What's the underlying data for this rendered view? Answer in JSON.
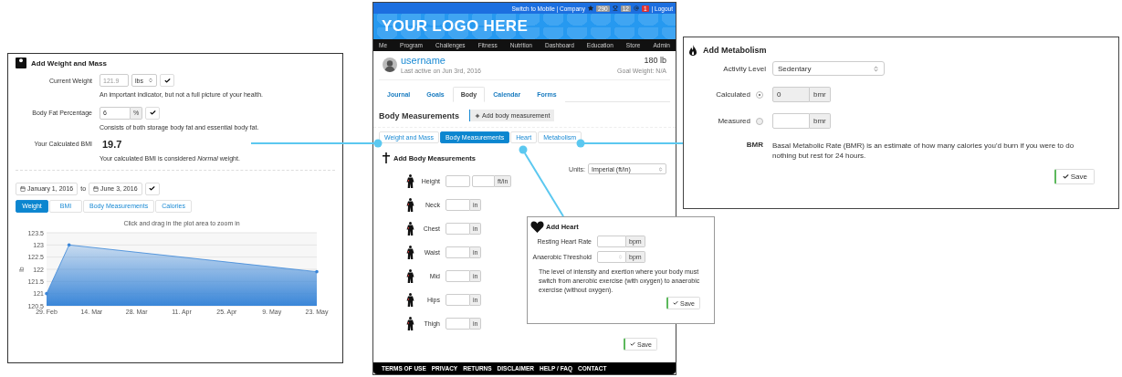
{
  "weight_panel": {
    "title": "Add Weight and Mass",
    "current_weight": {
      "label": "Current Weight",
      "placeholder": "121.9",
      "unit": "lbs",
      "help": "An important indicator, but not a full picture of your health."
    },
    "body_fat": {
      "label": "Body Fat Percentage",
      "value": "6",
      "unit": "%",
      "help": "Consists of both storage body fat and essential body fat."
    },
    "bmi": {
      "label": "Your Calculated BMI",
      "value": "19.7",
      "note": "Your calculated BMI is considered *Normal* weight."
    },
    "date_range": {
      "from": "January 1, 2016",
      "joiner": "to",
      "to": "June 3, 2016"
    },
    "tabs": [
      {
        "label": "Weight",
        "selected": true
      },
      {
        "label": "BMI",
        "selected": false
      },
      {
        "label": "Body Measurements",
        "selected": false
      },
      {
        "label": "Calories",
        "selected": false
      }
    ],
    "chart_data": {
      "type": "area",
      "title": "Click and drag in the plot area to zoom in",
      "ylabel": "lb",
      "categories": [
        "29. Feb",
        null,
        "14. Mar",
        null,
        "28. Mar",
        null,
        "11. Apr",
        null,
        "25. Apr",
        null,
        "9. May",
        null,
        "23. May"
      ],
      "ylim": [
        120.5,
        123.5
      ],
      "grid": "y",
      "series": [
        {
          "color": "#3a86d8",
          "values": [
            121,
            123,
            null,
            null,
            null,
            null,
            null,
            null,
            null,
            null,
            null,
            null,
            121.9
          ]
        }
      ],
      "yticks": [
        120.5,
        121,
        121.5,
        122,
        122.5,
        123,
        123.5
      ]
    }
  },
  "site": {
    "top_bar": {
      "links": "Switch to Mobile | Company",
      "stars": "290",
      "trophies": "12",
      "alerts": "1",
      "logout": "| Logout"
    },
    "logo": "YOUR LOGO HERE",
    "nav": [
      "Me",
      "Program",
      "Challenges",
      "Fitness",
      "Nutrition",
      "Dashboard",
      "Education",
      "Store",
      "Admin"
    ],
    "profile": {
      "username": "username",
      "last_active": "Last active on Jun 3rd, 2016",
      "weight": "180 lb",
      "goal": "Goal Weight: N/A"
    },
    "tabs": [
      {
        "label": "Journal",
        "selected": false
      },
      {
        "label": "Goals",
        "selected": false
      },
      {
        "label": "Body",
        "selected": true
      },
      {
        "label": "Calendar",
        "selected": false
      },
      {
        "label": "Forms",
        "selected": false
      }
    ],
    "section_title": "Body Measurements",
    "add_button": "Add body measurement",
    "subtabs": [
      {
        "label": "Weight and Mass",
        "selected": false
      },
      {
        "label": "Body Measurements",
        "selected": true
      },
      {
        "label": "Heart",
        "selected": false
      },
      {
        "label": "Metabolism",
        "selected": false
      }
    ],
    "form": {
      "title": "Add Body Measurements",
      "units_label": "Units:",
      "units_value": "Imperial (ft/in)",
      "rows": [
        {
          "label": "Height",
          "unit": "ft/in",
          "kind": "double"
        },
        {
          "label": "Neck",
          "unit": "in",
          "kind": "single"
        },
        {
          "label": "Chest",
          "unit": "in",
          "kind": "single"
        },
        {
          "label": "Waist",
          "unit": "in",
          "kind": "single"
        },
        {
          "label": "Mid",
          "unit": "in",
          "kind": "single"
        },
        {
          "label": "Hips",
          "unit": "in",
          "kind": "single"
        },
        {
          "label": "Thigh",
          "unit": "in",
          "kind": "single"
        }
      ],
      "save": "Save"
    },
    "footer": [
      "TERMS OF USE",
      "PRIVACY",
      "RETURNS",
      "DISCLAIMER",
      "HELP / FAQ",
      "CONTACT"
    ]
  },
  "heart_panel": {
    "title": "Add Heart",
    "fields": [
      {
        "label": "Resting Heart Rate",
        "unit": "bpm",
        "kind": "plain"
      },
      {
        "label": "Anaerobic Threshold",
        "unit": "bpm",
        "kind": "spinner"
      }
    ],
    "help": "The level of intensity and exertion where your body must switch from anerobic exercise (with oxygen) to anaerobic exercise (without oxygen).",
    "save": "Save"
  },
  "metabolism_panel": {
    "title": "Add Metabolism",
    "activity": {
      "label": "Activity Level",
      "value": "Sedentary"
    },
    "options": [
      {
        "label": "Calculated",
        "selected": true,
        "value": "0",
        "unit": "bmr"
      },
      {
        "label": "Measured",
        "selected": false,
        "unit": "bmr"
      }
    ],
    "bmr_term": "BMR",
    "bmr_text": "Basal Metabolic Rate (BMR) is an estimate of how many calories you'd burn if you were to do nothing but rest for 24 hours.",
    "save": "Save"
  }
}
